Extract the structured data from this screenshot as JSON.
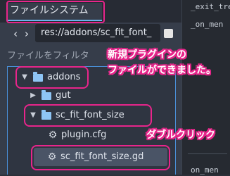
{
  "dock": {
    "title": "ファイルシステム"
  },
  "path_bar": {
    "back_icon": "chevron-left-icon",
    "forward_icon": "chevron-right-icon",
    "path_value": "res://addons/sc_fit_font_",
    "toggle_icon": "split-toggle-icon"
  },
  "filter": {
    "placeholder": "ファイルをフィルタ"
  },
  "tree": {
    "items": [
      {
        "label": "addons",
        "type": "folder",
        "expanded": true
      },
      {
        "label": "gut",
        "type": "folder",
        "expanded": false
      },
      {
        "label": "sc_fit_font_size",
        "type": "folder",
        "expanded": true
      },
      {
        "label": "plugin.cfg",
        "type": "config-file",
        "icon": "gear-icon"
      },
      {
        "label": "sc_fit_font_size.gd",
        "type": "script-file",
        "icon": "gear-icon",
        "selected": true
      }
    ]
  },
  "annotations": {
    "new_files_line1": "新規プラグインの",
    "new_files_line2": "ファイルができました。",
    "double_click": "ダブルクリック",
    "highlight_color": "#e8258b"
  },
  "right_panel": {
    "lines": [
      "_exit_tre",
      "_on_men",
      "on_men"
    ]
  },
  "colors": {
    "accent": "#69b4f0",
    "folder": "#8ec5f5",
    "selected_bg": "#4a5466"
  }
}
